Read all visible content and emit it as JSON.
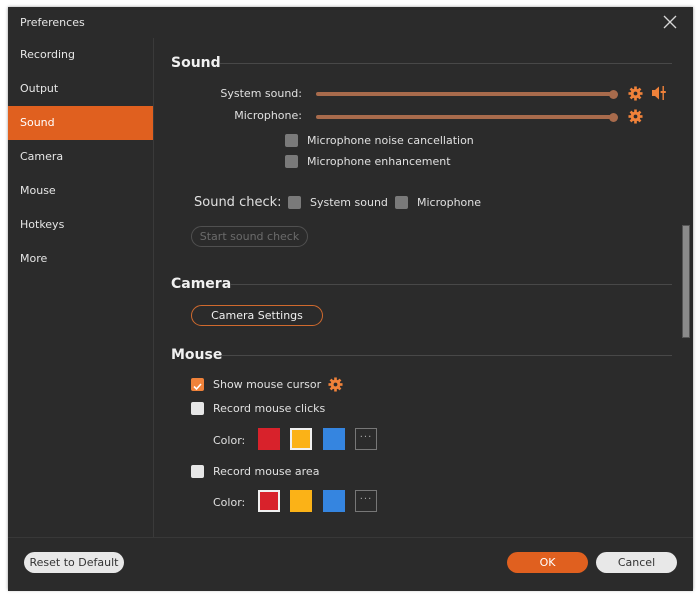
{
  "window": {
    "title": "Preferences",
    "close_icon": "close-icon"
  },
  "sidebar": {
    "items": [
      {
        "label": "Recording",
        "active": false
      },
      {
        "label": "Output",
        "active": false
      },
      {
        "label": "Sound",
        "active": true
      },
      {
        "label": "Camera",
        "active": false
      },
      {
        "label": "Mouse",
        "active": false
      },
      {
        "label": "Hotkeys",
        "active": false
      },
      {
        "label": "More",
        "active": false
      }
    ]
  },
  "sound": {
    "title": "Sound",
    "system_sound_label": "System sound:",
    "system_sound_volume_percent": 100,
    "microphone_label": "Microphone:",
    "microphone_volume_percent": 100,
    "noise_cancellation_label": "Microphone noise cancellation",
    "noise_cancellation_checked": false,
    "enhancement_label": "Microphone enhancement",
    "enhancement_checked": false,
    "sound_check_label": "Sound check:",
    "check_system_sound_label": "System sound",
    "check_system_sound_checked": false,
    "check_microphone_label": "Microphone",
    "check_microphone_checked": false,
    "start_button": "Start sound check"
  },
  "camera": {
    "title": "Camera",
    "settings_button": "Camera Settings"
  },
  "mouse": {
    "title": "Mouse",
    "show_cursor_label": "Show mouse cursor",
    "show_cursor_checked": true,
    "record_clicks_label": "Record mouse clicks",
    "record_clicks_checked": false,
    "clicks_color_label": "Color:",
    "clicks_colors": [
      "#d8222b",
      "#fbb217",
      "#3585e0"
    ],
    "clicks_selected_index": 1,
    "record_area_label": "Record mouse area",
    "record_area_checked": false,
    "area_color_label": "Color:",
    "area_colors": [
      "#d8222b",
      "#fbb217",
      "#3585e0"
    ],
    "area_selected_index": 0,
    "more_colors": "···"
  },
  "footer": {
    "reset_button": "Reset to Default",
    "ok_button": "OK",
    "cancel_button": "Cancel"
  },
  "colors": {
    "accent": "#e0601f",
    "slider": "#a86b4c",
    "icon_orange": "#f0823a"
  }
}
